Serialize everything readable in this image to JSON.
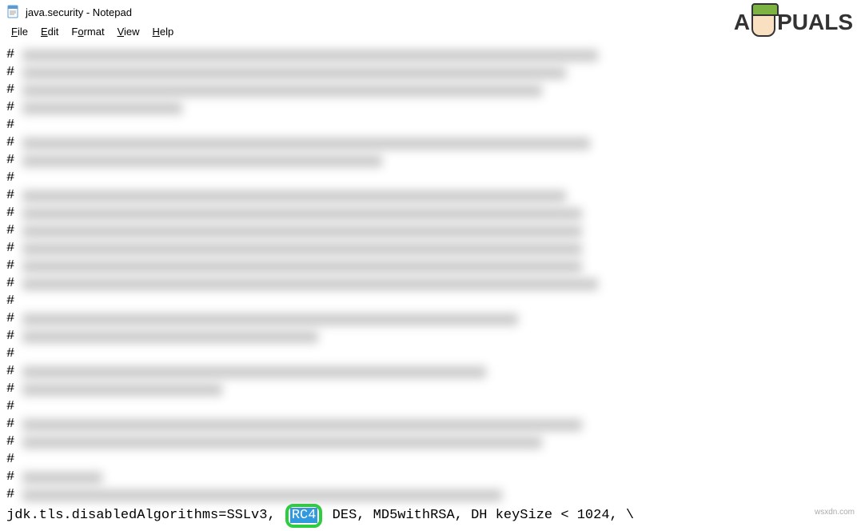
{
  "title": "java.security - Notepad",
  "menu": {
    "file": "File",
    "edit": "Edit",
    "format": "Format",
    "view": "View",
    "help": "Help"
  },
  "content": {
    "hash": "#",
    "line_prefix": "jdk.tls.disabledAlgorithms=SSLv3, ",
    "highlight": "RC4",
    "line_suffix": "  DES, MD5withRSA, DH keySize < 1024, \\"
  },
  "logo": {
    "prefix": "A",
    "suffix": "PUALS"
  },
  "watermark": "wsxdn.com",
  "blurred_widths": [
    [
      720
    ],
    [
      680
    ],
    [
      650
    ],
    [
      200
    ],
    [],
    [
      710
    ],
    [
      450
    ],
    [],
    [
      680
    ],
    [
      700
    ],
    [
      700
    ],
    [
      700
    ],
    [
      700
    ],
    [
      720
    ],
    [],
    [
      620
    ],
    [
      370
    ],
    [],
    [
      580
    ],
    [
      250
    ],
    [],
    [
      700
    ],
    [
      650
    ],
    [],
    [
      100
    ],
    [
      600
    ]
  ]
}
